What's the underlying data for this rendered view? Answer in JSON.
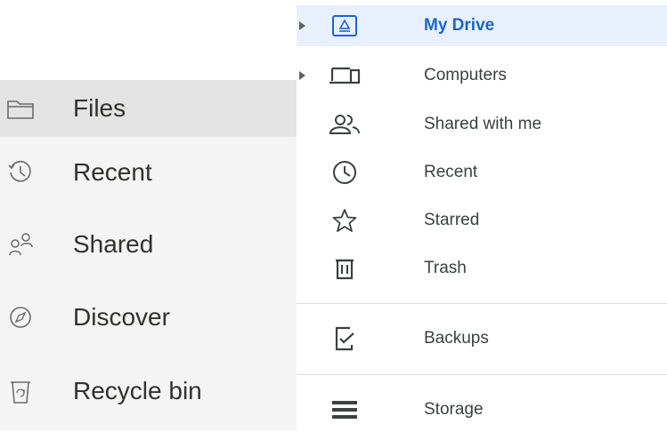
{
  "left_nav": {
    "items": [
      {
        "label": "Files",
        "icon": "folder-icon",
        "selected": true
      },
      {
        "label": "Recent",
        "icon": "history-icon",
        "selected": false
      },
      {
        "label": "Shared",
        "icon": "people-icon",
        "selected": false
      },
      {
        "label": "Discover",
        "icon": "compass-icon",
        "selected": false
      },
      {
        "label": "Recycle bin",
        "icon": "recycle-bin-icon",
        "selected": false
      }
    ]
  },
  "right_nav": {
    "items": [
      {
        "label": "My Drive",
        "icon": "drive-icon",
        "selected": true,
        "expandable": true
      },
      {
        "label": "Computers",
        "icon": "computers-icon",
        "selected": false,
        "expandable": true
      },
      {
        "label": "Shared with me",
        "icon": "shared-people-icon",
        "selected": false
      },
      {
        "label": "Recent",
        "icon": "clock-icon",
        "selected": false
      },
      {
        "label": "Starred",
        "icon": "star-icon",
        "selected": false
      },
      {
        "label": "Trash",
        "icon": "trash-icon",
        "selected": false
      },
      {
        "label": "Backups",
        "icon": "backup-icon",
        "selected": false
      },
      {
        "label": "Storage",
        "icon": "storage-icon",
        "selected": false
      }
    ]
  },
  "colors": {
    "left_panel_bg": "#f4f4f4",
    "left_selected_bg": "#e3e3e3",
    "right_selected_bg": "#e8f0fe",
    "right_selected_text": "#1967d2",
    "icon_gray": "#5f6368"
  }
}
